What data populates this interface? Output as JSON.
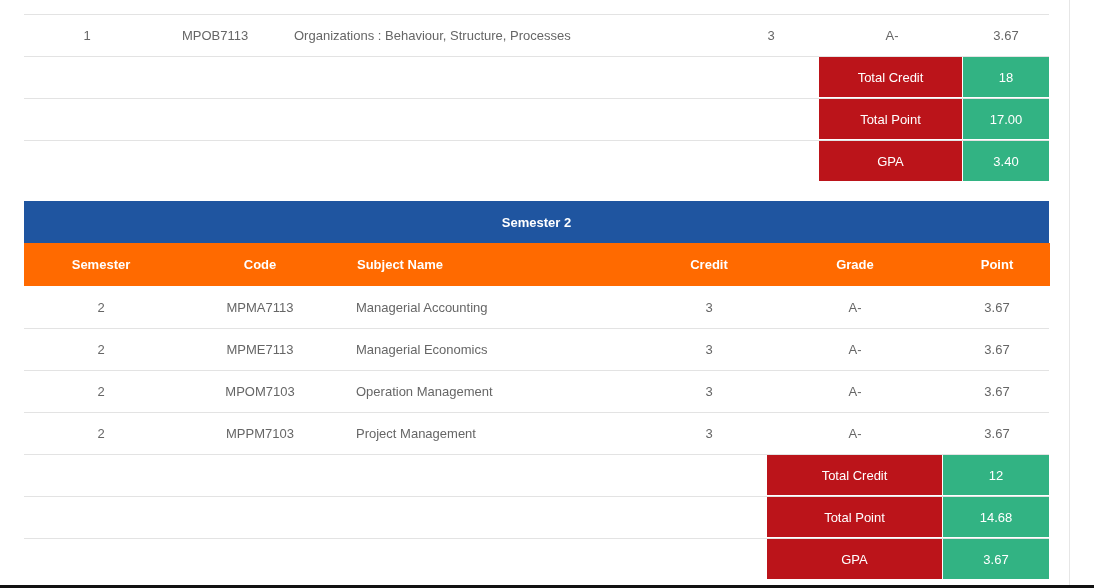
{
  "semesters": [
    {
      "rows": [
        {
          "semester": "1",
          "code": "MPOB7113",
          "subject": "Organizations : Behaviour, Structure, Processes",
          "credit": "3",
          "grade": "A-",
          "point": "3.67"
        }
      ],
      "summary": [
        {
          "label": "Total Credit",
          "value": "18"
        },
        {
          "label": "Total Point",
          "value": "17.00"
        },
        {
          "label": "GPA",
          "value": "3.40"
        }
      ]
    },
    {
      "title": "Semester 2",
      "columns": [
        "Semester",
        "Code",
        "Subject Name",
        "Credit",
        "Grade",
        "Point"
      ],
      "rows": [
        {
          "semester": "2",
          "code": "MPMA7113",
          "subject": "Managerial Accounting",
          "credit": "3",
          "grade": "A-",
          "point": "3.67"
        },
        {
          "semester": "2",
          "code": "MPME7113",
          "subject": "Managerial Economics",
          "credit": "3",
          "grade": "A-",
          "point": "3.67"
        },
        {
          "semester": "2",
          "code": "MPOM7103",
          "subject": "Operation Management",
          "credit": "3",
          "grade": "A-",
          "point": "3.67"
        },
        {
          "semester": "2",
          "code": "MPPM7103",
          "subject": "Project Management",
          "credit": "3",
          "grade": "A-",
          "point": "3.67"
        }
      ],
      "summary": [
        {
          "label": "Total Credit",
          "value": "12"
        },
        {
          "label": "Total Point",
          "value": "14.68"
        },
        {
          "label": "GPA",
          "value": "3.67"
        }
      ]
    }
  ]
}
